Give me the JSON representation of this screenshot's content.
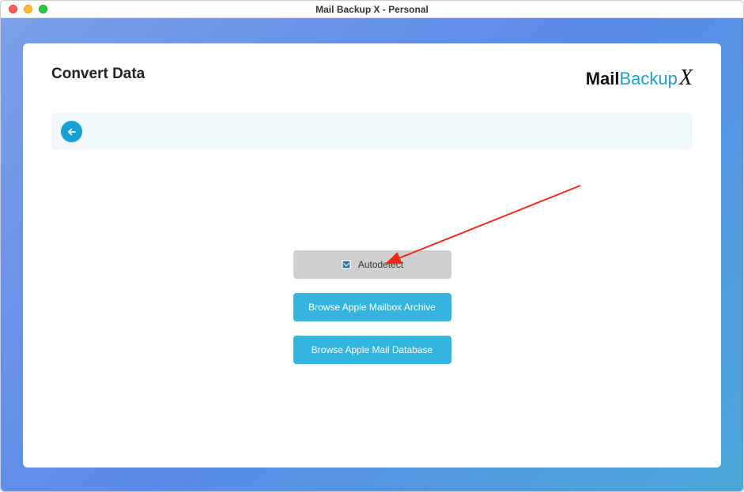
{
  "window": {
    "title": "Mail Backup X - Personal"
  },
  "header": {
    "page_title": "Convert Data",
    "logo_mail": "Mail",
    "logo_backup": "Backup",
    "logo_x": "X"
  },
  "buttons": {
    "autodetect": "Autodetect",
    "browse_archive": "Browse Apple Mailbox Archive",
    "browse_database": "Browse Apple Mail Database"
  },
  "icons": {
    "back": "arrow-left",
    "stamp": "apple-mail-stamp"
  },
  "colors": {
    "accent_blue": "#17a0d4",
    "button_blue": "#34b5df",
    "button_grey": "#cfcfcf",
    "gradient_start": "#7b9fe8",
    "gradient_end": "#4aa8d8",
    "annotation_red": "#ed2a1c"
  },
  "annotation": {
    "arrow_points_to": "autodetect-button"
  }
}
